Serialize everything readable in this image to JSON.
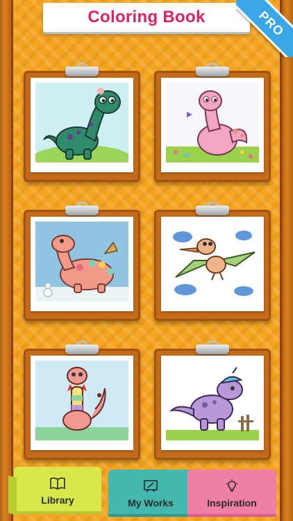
{
  "header": {
    "title": "Coloring Book",
    "pro_badge": "PRO"
  },
  "gallery": {
    "items": [
      {
        "name": "green-dinosaur-with-flower",
        "colors": [
          "#cfeff5",
          "#2e8a6b",
          "#6e3b8c"
        ]
      },
      {
        "name": "pink-dinosaur-in-flowers",
        "colors": [
          "#f7f6fb",
          "#f0a6c4",
          "#9ad04a"
        ]
      },
      {
        "name": "pink-dinosaur-with-pterodactyl",
        "colors": [
          "#8fc5e0",
          "#f29a8a",
          "#7bd6b8"
        ]
      },
      {
        "name": "pterodactyl-in-clouds",
        "colors": [
          "#ffffff",
          "#a3d27a",
          "#f0b58a"
        ]
      },
      {
        "name": "rainbow-dinosaur-with-bowtie",
        "colors": [
          "#cfeaf5",
          "#f19a92",
          "#8ed39a"
        ]
      },
      {
        "name": "purple-dinosaur-with-cap",
        "colors": [
          "#ffffff",
          "#b998d8",
          "#5fc1de"
        ]
      }
    ]
  },
  "tabs": {
    "library": "Library",
    "my_works": "My Works",
    "inspiration": "Inspiration"
  },
  "colors": {
    "background": "#f4a520",
    "title": "#d9245f",
    "pro": "#3aa7e6",
    "tab_library": "#d6e84b",
    "tab_my_works": "#43b8ae",
    "tab_inspiration": "#f07fa8"
  }
}
